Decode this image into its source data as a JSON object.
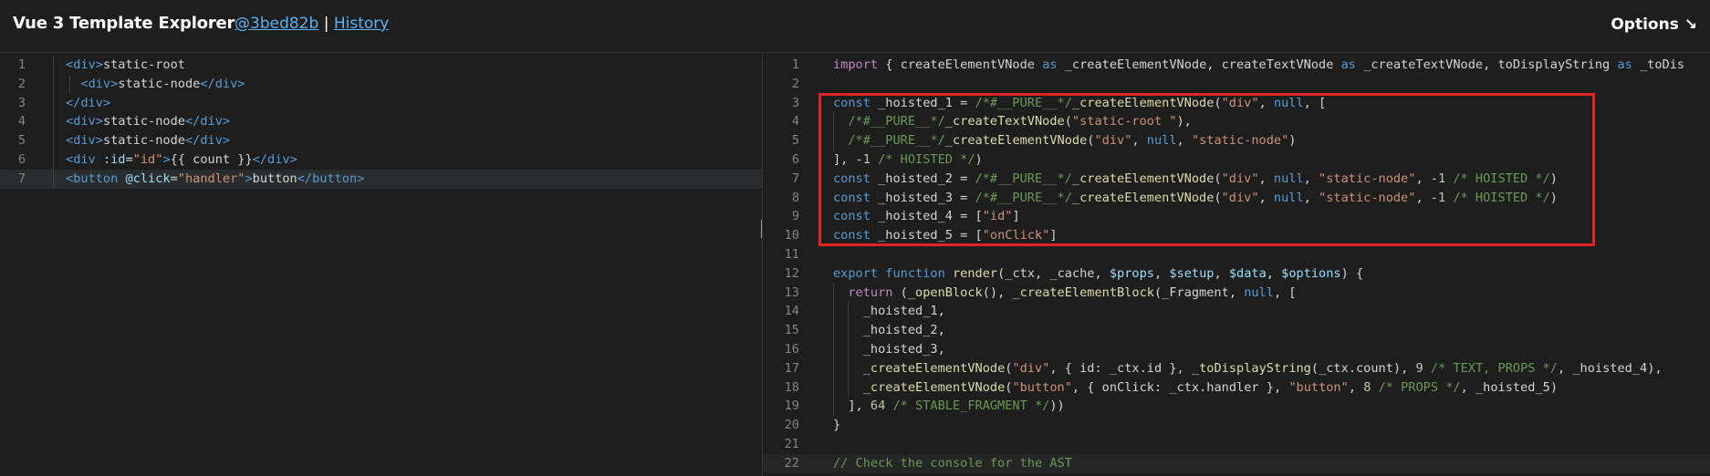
{
  "header": {
    "title": "Vue 3 Template Explorer",
    "commit": "@3bed82b",
    "separator": "|",
    "history": "History",
    "options": "Options ↘"
  },
  "template_lines": [
    {
      "n": "1",
      "text": "<div>static-root"
    },
    {
      "n": "2",
      "text": "  <div>static-node</div>"
    },
    {
      "n": "3",
      "text": "</div>"
    },
    {
      "n": "4",
      "text": "<div>static-node</div>"
    },
    {
      "n": "5",
      "text": "<div>static-node</div>"
    },
    {
      "n": "6",
      "text": "<div :id=\"id\">{{ count }}</div>"
    },
    {
      "n": "7",
      "text": "<button @click=\"handler\">button</button>"
    }
  ],
  "output_lines": [
    {
      "n": "1",
      "text": "import { createElementVNode as _createElementVNode, createTextVNode as _createTextVNode, toDisplayString as _toDis"
    },
    {
      "n": "2",
      "text": ""
    },
    {
      "n": "3",
      "text": "const _hoisted_1 = /*#__PURE__*/_createElementVNode(\"div\", null, ["
    },
    {
      "n": "4",
      "text": "  /*#__PURE__*/_createTextVNode(\"static-root \"),"
    },
    {
      "n": "5",
      "text": "  /*#__PURE__*/_createElementVNode(\"div\", null, \"static-node\")"
    },
    {
      "n": "6",
      "text": "], -1 /* HOISTED */)"
    },
    {
      "n": "7",
      "text": "const _hoisted_2 = /*#__PURE__*/_createElementVNode(\"div\", null, \"static-node\", -1 /* HOISTED */)"
    },
    {
      "n": "8",
      "text": "const _hoisted_3 = /*#__PURE__*/_createElementVNode(\"div\", null, \"static-node\", -1 /* HOISTED */)"
    },
    {
      "n": "9",
      "text": "const _hoisted_4 = [\"id\"]"
    },
    {
      "n": "10",
      "text": "const _hoisted_5 = [\"onClick\"]"
    },
    {
      "n": "11",
      "text": ""
    },
    {
      "n": "12",
      "text": "export function render(_ctx, _cache, $props, $setup, $data, $options) {"
    },
    {
      "n": "13",
      "text": "  return (_openBlock(), _createElementBlock(_Fragment, null, ["
    },
    {
      "n": "14",
      "text": "    _hoisted_1,"
    },
    {
      "n": "15",
      "text": "    _hoisted_2,"
    },
    {
      "n": "16",
      "text": "    _hoisted_3,"
    },
    {
      "n": "17",
      "text": "    _createElementVNode(\"div\", { id: _ctx.id }, _toDisplayString(_ctx.count), 9 /* TEXT, PROPS */, _hoisted_4),"
    },
    {
      "n": "18",
      "text": "    _createElementVNode(\"button\", { onClick: _ctx.handler }, \"button\", 8 /* PROPS */, _hoisted_5)"
    },
    {
      "n": "19",
      "text": "  ], 64 /* STABLE_FRAGMENT */))"
    },
    {
      "n": "20",
      "text": "}"
    },
    {
      "n": "21",
      "text": ""
    },
    {
      "n": "22",
      "text": "// Check the console for the AST"
    }
  ],
  "colors": {
    "background": "#1e1e1e",
    "highlight_box": "#e02424",
    "link": "#5ab3f5"
  }
}
